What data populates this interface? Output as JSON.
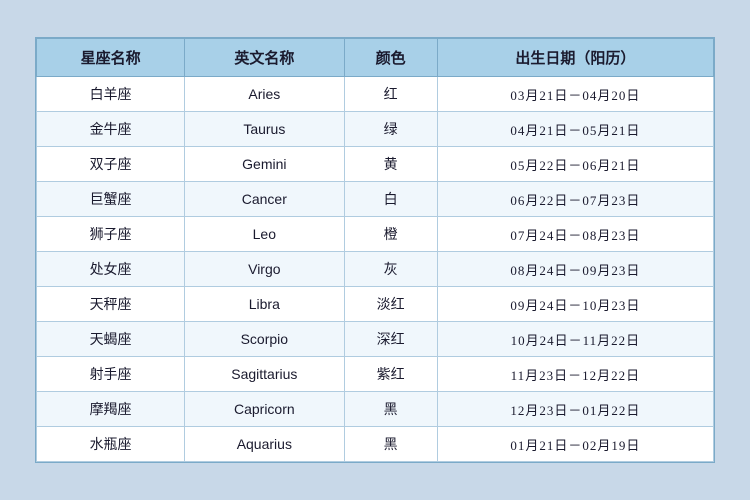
{
  "table": {
    "headers": [
      "星座名称",
      "英文名称",
      "颜色",
      "出生日期（阳历）"
    ],
    "rows": [
      {
        "zh": "白羊座",
        "en": "Aries",
        "color": "红",
        "dates": "03月21日－04月20日"
      },
      {
        "zh": "金牛座",
        "en": "Taurus",
        "color": "绿",
        "dates": "04月21日－05月21日"
      },
      {
        "zh": "双子座",
        "en": "Gemini",
        "color": "黄",
        "dates": "05月22日－06月21日"
      },
      {
        "zh": "巨蟹座",
        "en": "Cancer",
        "color": "白",
        "dates": "06月22日－07月23日"
      },
      {
        "zh": "狮子座",
        "en": "Leo",
        "color": "橙",
        "dates": "07月24日－08月23日"
      },
      {
        "zh": "处女座",
        "en": "Virgo",
        "color": "灰",
        "dates": "08月24日－09月23日"
      },
      {
        "zh": "天秤座",
        "en": "Libra",
        "color": "淡红",
        "dates": "09月24日－10月23日"
      },
      {
        "zh": "天蝎座",
        "en": "Scorpio",
        "color": "深红",
        "dates": "10月24日－11月22日"
      },
      {
        "zh": "射手座",
        "en": "Sagittarius",
        "color": "紫红",
        "dates": "11月23日－12月22日"
      },
      {
        "zh": "摩羯座",
        "en": "Capricorn",
        "color": "黑",
        "dates": "12月23日－01月22日"
      },
      {
        "zh": "水瓶座",
        "en": "Aquarius",
        "color": "黑",
        "dates": "01月21日－02月19日"
      }
    ]
  }
}
